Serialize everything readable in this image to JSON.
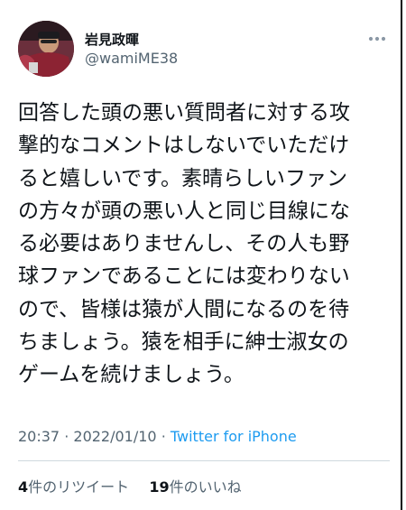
{
  "author": {
    "display_name": "岩見政暉",
    "handle": "@wamiME38"
  },
  "tweet": {
    "text": "回答した頭の悪い質問者に対する攻\n撃的なコメントはしないでいただけ\nると嬉しいです。素晴らしいファン\nの方々が頭の悪い人と同じ目線にな\nる必要はありませんし、その人も野\n球ファンであることには変わりない\nので、皆様は猿が人間になるのを待\nちましょう。猿を相手に紳士淑女の\nゲームを続けましょう。",
    "time": "20:37",
    "separator": "·",
    "date": "2022/01/10",
    "source": "Twitter for iPhone"
  },
  "stats": {
    "retweets_count": "4",
    "retweets_label": "件のリツイート",
    "likes_count": "19",
    "likes_label": "件のいいね"
  },
  "icons": {
    "more": "more-horizontal-icon"
  },
  "colors": {
    "text": "#0f1419",
    "secondary": "#536471",
    "link": "#1d9bf0",
    "divider": "#cfd9de"
  }
}
